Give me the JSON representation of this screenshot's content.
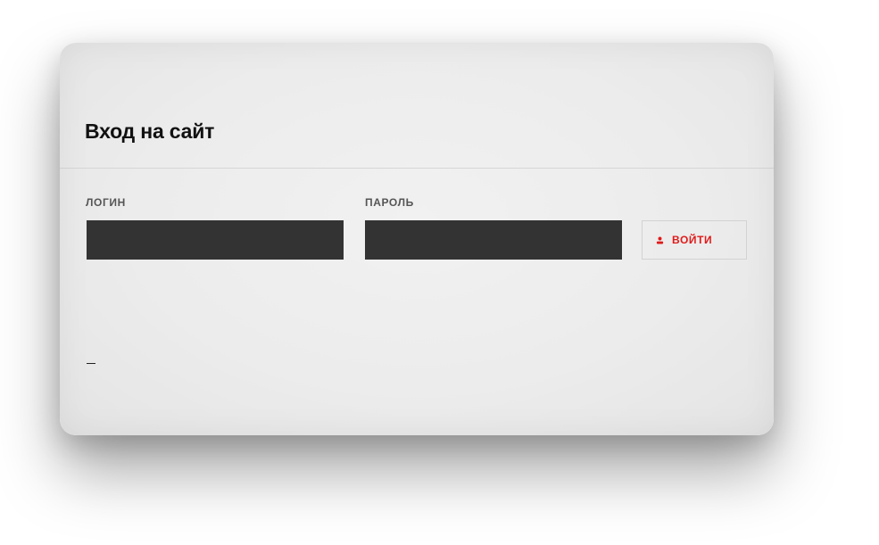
{
  "dialog": {
    "title": "Вход на сайт"
  },
  "form": {
    "login_label": "ЛОГИН",
    "login_value": "",
    "password_label": "ПАРОЛЬ",
    "password_value": "",
    "submit_label": "ВОЙТИ",
    "submit_icon": "user-icon"
  },
  "colors": {
    "accent": "#e01a1a",
    "input_background": "#333333",
    "dialog_background": "#ececec"
  }
}
